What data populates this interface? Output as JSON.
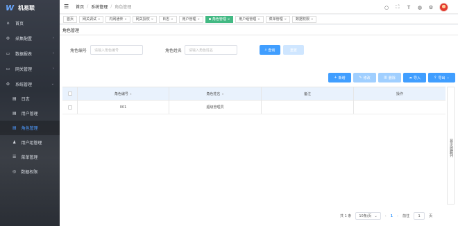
{
  "app": {
    "logo_mark": "W",
    "name": "机易联"
  },
  "sidebar": {
    "items": [
      {
        "label": "首页",
        "icon": "home-icon"
      },
      {
        "label": "采集配置",
        "icon": "gear-icon"
      },
      {
        "label": "数据报表",
        "icon": "chart-icon"
      },
      {
        "label": "网关管理",
        "icon": "gateway-icon"
      },
      {
        "label": "系统管理",
        "icon": "system-icon"
      }
    ],
    "sub_items": [
      {
        "label": "日志",
        "icon": "log-icon"
      },
      {
        "label": "用户管理",
        "icon": "user-icon"
      },
      {
        "label": "角色管理",
        "icon": "role-icon"
      },
      {
        "label": "用户组管理",
        "icon": "group-icon"
      },
      {
        "label": "菜单管理",
        "icon": "menu-icon"
      },
      {
        "label": "数据权限",
        "icon": "permission-icon"
      }
    ]
  },
  "header": {
    "breadcrumb": [
      "首页",
      "系统管理",
      "角色管理"
    ]
  },
  "tags": [
    {
      "label": "首页"
    },
    {
      "label": "网关调试"
    },
    {
      "label": "内网通传"
    },
    {
      "label": "网关授权"
    },
    {
      "label": "日志"
    },
    {
      "label": "用户管理"
    },
    {
      "label": "角色管理"
    },
    {
      "label": "用户组管理"
    },
    {
      "label": "菜单管理"
    },
    {
      "label": "数据权限"
    }
  ],
  "panel": {
    "title": "角色管理"
  },
  "search": {
    "code_label": "角色编号",
    "code_placeholder": "请输入角色编号",
    "name_label": "角色姓名",
    "name_placeholder": "请输入角色姓名",
    "query_label": "查询",
    "reset_label": "重置"
  },
  "toolbar": {
    "add": "新增",
    "edit": "修改",
    "delete": "删除",
    "import": "导入",
    "export": "导出"
  },
  "table": {
    "columns": [
      "角色编号",
      "角色姓名",
      "备注",
      "操作"
    ],
    "rows": [
      {
        "code": "001",
        "name": "超级管理员",
        "remark": "",
        "action": ""
      }
    ]
  },
  "side_tab": "显示/隐藏列",
  "pagination": {
    "total": "共 1 条",
    "page_size": "10条/页",
    "current_page": "1",
    "goto_label": "前往",
    "goto_value": "1",
    "page_unit": "页"
  },
  "colors": {
    "accent": "#409eff",
    "active_tag": "#42b983",
    "sidebar_bg": "#2f3542"
  }
}
